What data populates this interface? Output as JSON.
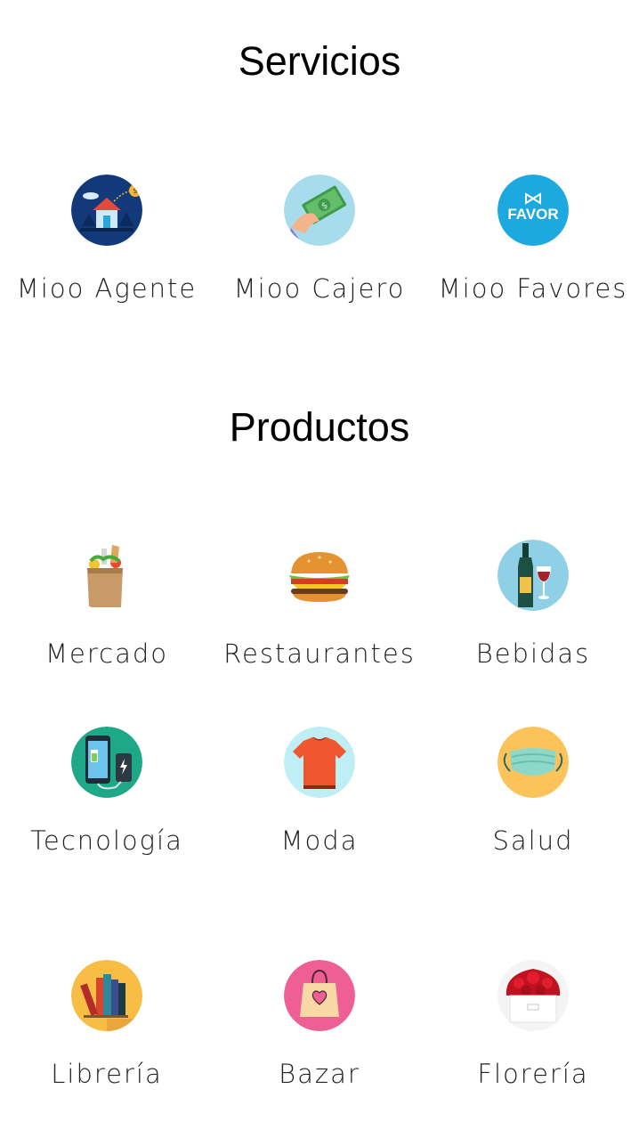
{
  "servicios": {
    "title": "Servicios",
    "items": [
      {
        "label": "Mioo Agente",
        "icon": "house-agent-icon"
      },
      {
        "label": "Mioo Cajero",
        "icon": "cash-hand-icon"
      },
      {
        "label": "Mioo Favores",
        "icon": "favor-badge-icon",
        "badge_text": "FAVOR"
      }
    ]
  },
  "productos": {
    "title": "Productos",
    "items": [
      {
        "label": "Mercado",
        "icon": "grocery-bag-icon"
      },
      {
        "label": "Restaurantes",
        "icon": "burger-icon"
      },
      {
        "label": "Bebidas",
        "icon": "wine-bottle-glass-icon"
      },
      {
        "label": "Tecnología",
        "icon": "phone-charger-icon"
      },
      {
        "label": "Moda",
        "icon": "tshirt-icon"
      },
      {
        "label": "Salud",
        "icon": "face-mask-icon"
      },
      {
        "label": "Librería",
        "icon": "books-icon"
      },
      {
        "label": "Bazar",
        "icon": "gift-bag-icon"
      },
      {
        "label": "Florería",
        "icon": "rose-box-icon"
      }
    ]
  },
  "colors": {
    "agent_bg": "#12397a",
    "cajero_bg": "#a6dcec",
    "favor_bg": "#1ea8e0",
    "bebidas_bg": "#8fd0e6",
    "tecnologia_bg": "#1fa888",
    "moda_bg": "#bfeef4",
    "salud_bg": "#fbc35a",
    "libreria_bg": "#f8bd45",
    "bazar_bg": "#ee5f96"
  }
}
